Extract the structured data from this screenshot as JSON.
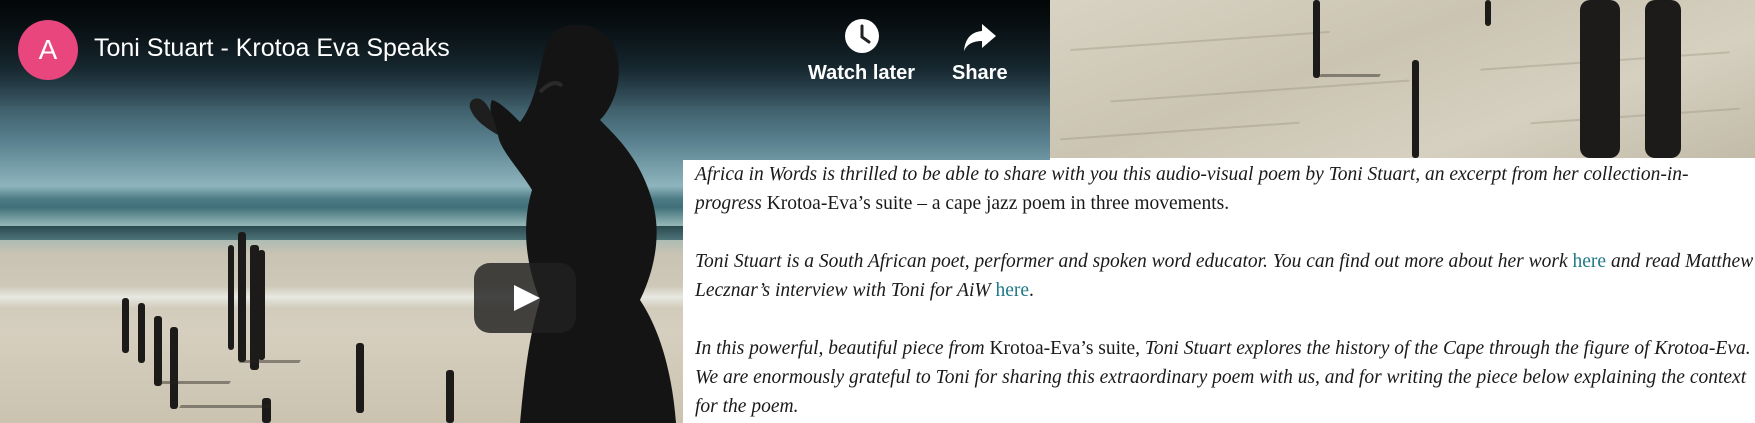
{
  "video": {
    "channel_initial": "A",
    "title": "Toni Stuart - Krotoa Eva Speaks",
    "actions": {
      "watch_later": "Watch later",
      "share": "Share"
    },
    "play_icon": "play-icon",
    "avatar_color": "#e8467c"
  },
  "article": {
    "p1": {
      "a": "Africa in Words is thrilled to be able to share with you this audio-visual poem by Toni Stuart, an excerpt from her collection-in-progress",
      "b": " Krotoa-Eva’s suite – a cape jazz poem in three movements."
    },
    "p2": {
      "a": "Toni Stuart is a South African poet, performer and spoken word educator. You can find out more about her work ",
      "link1": "here",
      "b": " and read Matthew Lecznar’s interview with Toni for AiW ",
      "link2": "here",
      "c": "."
    },
    "p3": {
      "a": "In this powerful, beautiful piece from ",
      "b": "Krotoa-Eva’s suite",
      "c": ", Toni Stuart explores the history of the Cape through the figure of Krotoa-Eva. We are enormously grateful to Toni for sharing this extraordinary poem with us, and for writing the piece below explaining the context for the poem."
    },
    "link_color": "#1f7a86"
  }
}
